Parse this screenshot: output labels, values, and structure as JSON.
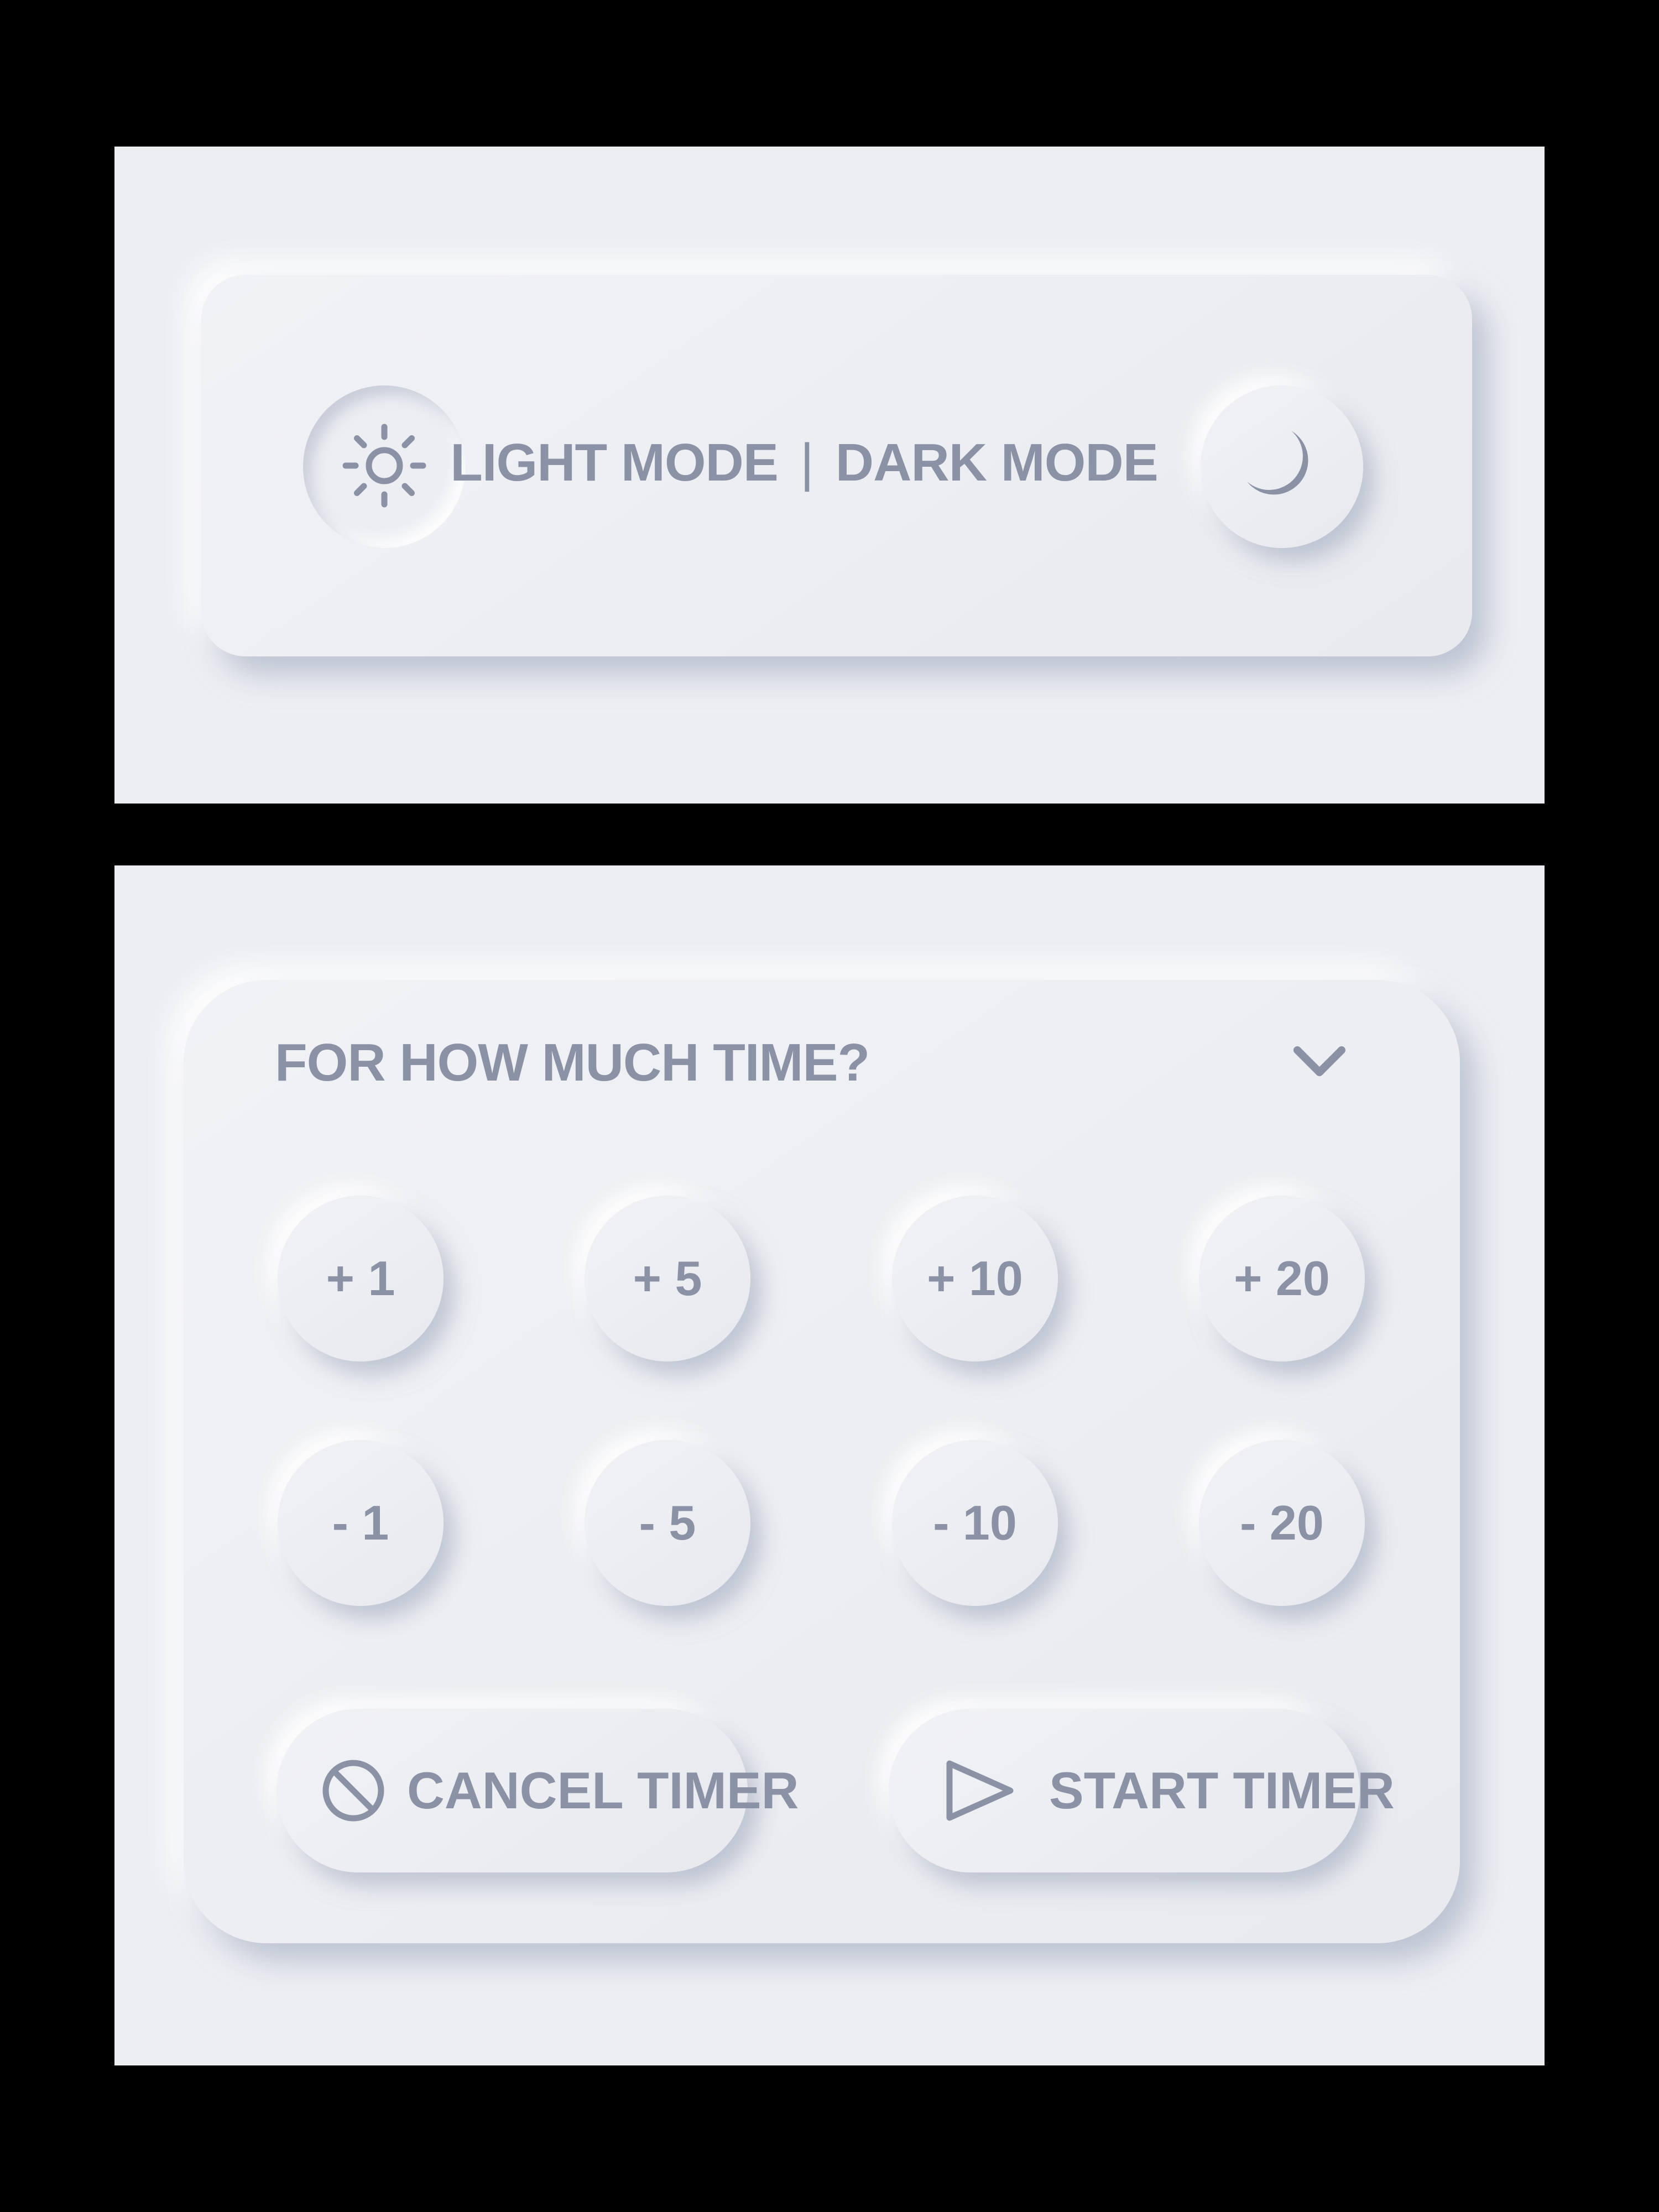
{
  "theme": {
    "background": "#eceef2",
    "text_color": "#8b92a6",
    "icon_color": "#8b92a6",
    "outer_background": "#000000"
  },
  "mode_toggle": {
    "light_label": "LIGHT MODE",
    "separator": "|",
    "dark_label": "DARK MODE",
    "light_icon": "sun-icon",
    "dark_icon": "moon-icon",
    "active_mode": "light"
  },
  "timer": {
    "title": "FOR HOW MUCH TIME?",
    "dropdown_icon": "chevron-down-icon",
    "add_buttons": [
      "+ 1",
      "+ 5",
      "+ 10",
      "+ 20"
    ],
    "subtract_buttons": [
      "- 1",
      "- 5",
      "- 10",
      "- 20"
    ],
    "cancel_label": "CANCEL TIMER",
    "cancel_icon": "prohibited-icon",
    "start_label": "START TIMER",
    "start_icon": "play-icon"
  }
}
